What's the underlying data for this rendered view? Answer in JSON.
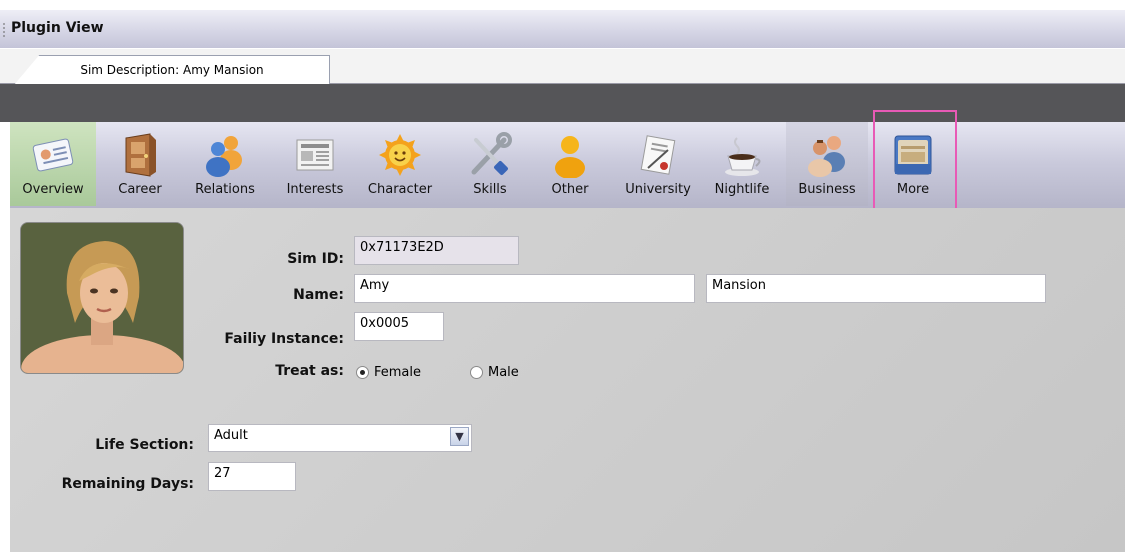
{
  "panel": {
    "title": "Plugin View"
  },
  "tabs": [
    {
      "label": "Sim Description: Amy Mansion"
    }
  ],
  "toolbar": {
    "items": [
      {
        "label": "Overview",
        "icon": "overview-card-icon"
      },
      {
        "label": "Career",
        "icon": "career-door-icon"
      },
      {
        "label": "Relations",
        "icon": "relations-people-icon"
      },
      {
        "label": "Interests",
        "icon": "interests-newspaper-icon"
      },
      {
        "label": "Character",
        "icon": "character-sun-icon"
      },
      {
        "label": "Skills",
        "icon": "skills-tools-icon"
      },
      {
        "label": "Other",
        "icon": "other-person-icon"
      },
      {
        "label": "University",
        "icon": "university-diploma-icon"
      },
      {
        "label": "Nightlife",
        "icon": "nightlife-coffee-icon"
      },
      {
        "label": "Business",
        "icon": "business-people-icon"
      },
      {
        "label": "More",
        "icon": "more-folder-icon"
      }
    ],
    "selected": "Overview",
    "highlighted": "More"
  },
  "form": {
    "sim_id": {
      "label": "Sim ID:",
      "value": "0x71173E2D"
    },
    "name": {
      "label": "Name:",
      "first": "Amy",
      "last": "Mansion"
    },
    "family": {
      "label": "Failiy Instance:",
      "value": "0x0005"
    },
    "treat_as": {
      "label": "Treat as:",
      "options": [
        "Female",
        "Male"
      ],
      "selected": "Female"
    },
    "life_section": {
      "label": "Life Section:",
      "value": "Adult"
    },
    "remaining_days": {
      "label": "Remaining Days:",
      "value": "27"
    }
  },
  "colors": {
    "highlight": "#e85ab6",
    "selected_tool": "#b7d4a8",
    "dark_bar": "#555558"
  }
}
